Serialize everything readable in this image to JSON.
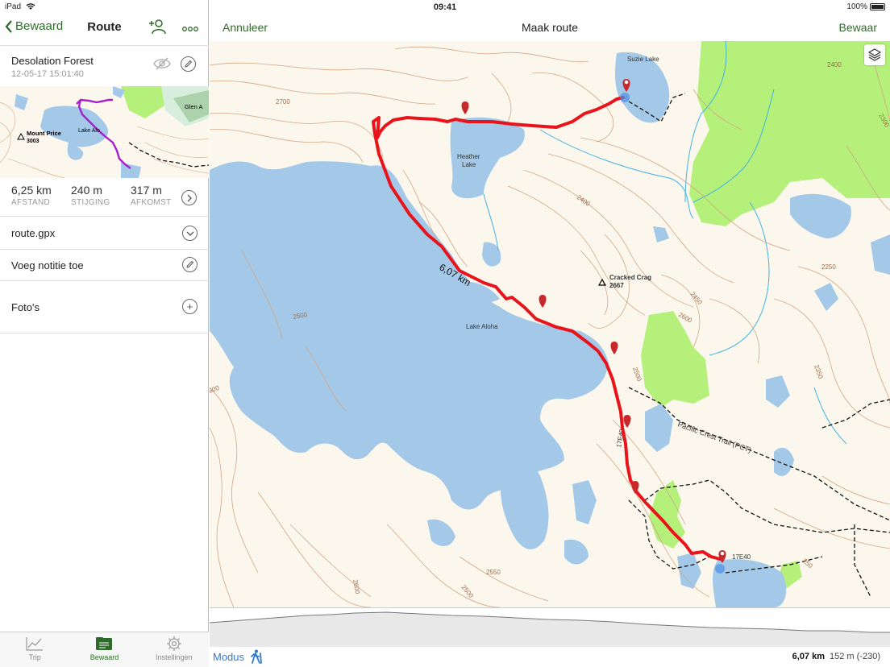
{
  "status": {
    "device": "iPad",
    "time": "09:41",
    "battery": "100%"
  },
  "left_nav": {
    "back_label": "Bewaard",
    "title": "Route"
  },
  "trip": {
    "name": "Desolation Forest",
    "date": "12-05-17 15:01:40"
  },
  "thumb_labels": {
    "peak": "Mount Price",
    "peak_alt": "3003",
    "lake": "Lake Alo",
    "place": "Glen A"
  },
  "stats": [
    {
      "value": "6,25 km",
      "label": "AFSTAND"
    },
    {
      "value": "240 m",
      "label": "STIJGING"
    },
    {
      "value": "317 m",
      "label": "AFKOMST"
    }
  ],
  "rows": {
    "gpx": "route.gpx",
    "note": "Voeg notitie toe",
    "photos": "Foto's"
  },
  "tabs": [
    {
      "label": "Trip",
      "icon": "chart-icon"
    },
    {
      "label": "Bewaard",
      "icon": "folder-icon"
    },
    {
      "label": "Instellingen",
      "icon": "gear-icon"
    }
  ],
  "right_nav": {
    "cancel": "Annuleer",
    "title": "Maak route",
    "save": "Bewaar"
  },
  "map_labels": {
    "suzie_lake": "Suzie Lake",
    "heather_lake_1": "Heather",
    "heather_lake_2": "Lake",
    "lake_aloha": "Lake Aloha",
    "cracked_crag": "Cracked Crag",
    "cracked_crag_alt": "2667",
    "route_distance": "6,07 km",
    "trail_name": "Pacific Crest Trail (PCT)",
    "road_code_1": "17E40",
    "road_code_2": "17E40",
    "c2700": "2700",
    "c2400a": "2400",
    "c2400b": "2400",
    "c2300": "2300",
    "c2250": "2250",
    "c2450": "2450",
    "c2600a": "2600",
    "c2500a": "2500",
    "c2350": "2350",
    "c2500b": "2500",
    "c2550": "2550",
    "c2500c": "2500",
    "c2600b": "2600",
    "c2600c": "600",
    "c2500d": "250"
  },
  "bottom": {
    "mode": "Modus",
    "distance": "6,07 km",
    "elevation": "152 m (-230)"
  },
  "colors": {
    "accent": "#2e6b2a",
    "route": "#e8131b",
    "water": "#a3c8e8",
    "forest": "#b4f07a",
    "contour": "#d4a584",
    "land": "#fbf7ec"
  }
}
